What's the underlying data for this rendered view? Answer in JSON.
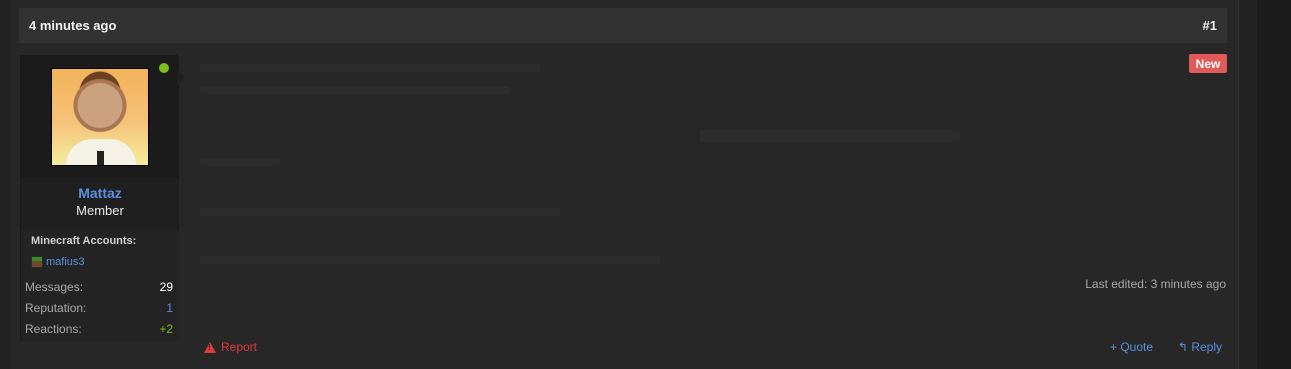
{
  "post": {
    "time": "4 minutes ago",
    "number": "#1",
    "badge": "New",
    "last_edited": "Last edited: 3 minutes ago"
  },
  "user": {
    "name": "Mattaz",
    "title": "Member",
    "minecraft_label": "Minecraft Accounts:",
    "minecraft_account": "mafius3",
    "online": true,
    "stats": [
      {
        "label": "Messages:",
        "value": "29"
      },
      {
        "label": "Reputation:",
        "value": "1"
      },
      {
        "label": "Reactions:",
        "value": "+2"
      }
    ]
  },
  "actions": {
    "report": "Report",
    "quote": "+ Quote",
    "reply": "Reply"
  },
  "colors": {
    "accent_blue": "#5a8fe0",
    "report_red": "#e2383f",
    "badge_red": "#e05a5a",
    "online_green": "#7bbf1a"
  },
  "icons": [
    "warning-icon",
    "reply-icon",
    "minecraft-head-icon"
  ]
}
